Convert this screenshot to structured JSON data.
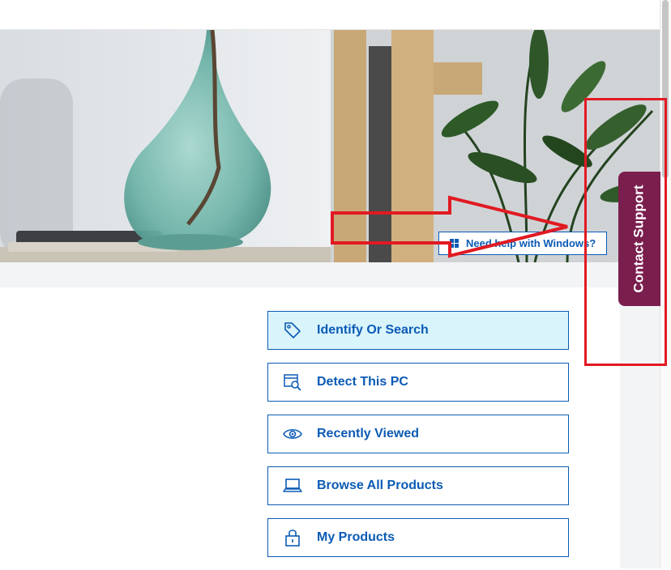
{
  "hero": {
    "help_button_label": "Need help with Windows?",
    "help_button_icon": "windows-logo-icon"
  },
  "contact_tab": {
    "label": "Contact Support"
  },
  "menu": {
    "items": [
      {
        "label": "Identify Or Search",
        "icon": "tag-icon",
        "active": true
      },
      {
        "label": "Detect This PC",
        "icon": "detect-pc-icon",
        "active": false
      },
      {
        "label": "Recently Viewed",
        "icon": "eye-icon",
        "active": false
      },
      {
        "label": "Browse All Products",
        "icon": "laptop-icon",
        "active": false
      },
      {
        "label": "My Products",
        "icon": "lock-icon",
        "active": false
      }
    ]
  },
  "colors": {
    "accent": "#0b5bb5",
    "active_bg": "#d9f4fb",
    "contact_tab_bg": "#7a1e4e",
    "annotation_red": "#e11a22"
  }
}
